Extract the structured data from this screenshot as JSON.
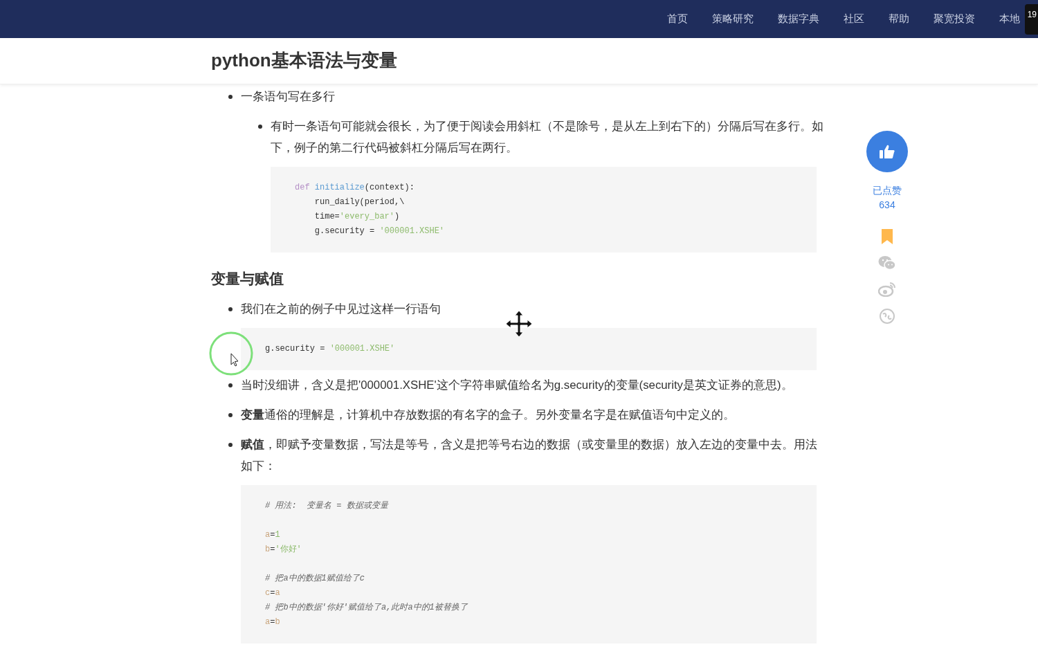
{
  "nav": {
    "items": [
      {
        "label": "首页",
        "selected": false
      },
      {
        "label": "策略研究",
        "selected": false
      },
      {
        "label": "数据字典",
        "selected": false
      },
      {
        "label": "社区",
        "selected": false
      },
      {
        "label": "帮助",
        "selected": false
      },
      {
        "label": "聚宽投资",
        "selected": false
      },
      {
        "label": "本地",
        "selected": false
      }
    ],
    "tooltip": "19"
  },
  "title": "python基本语法与变量",
  "content": [
    {
      "kind": "bullet",
      "text": "一条语句写在多行",
      "children": [
        {
          "kind": "bullet",
          "text": "有时一条语句可能就会很长，为了便于阅读会用斜杠（不是除号，是从左上到右下的）分隔后写在多行。如下，例子的第二行代码被斜杠分隔后写在两行。",
          "children": [
            {
              "kind": "code",
              "lines": [
                {
                  "kind": "code",
                  "segments": [
                    {
                      "kind": "keyword",
                      "text": "def "
                    },
                    {
                      "kind": "function",
                      "text": "initialize"
                    },
                    {
                      "kind": "plain",
                      "text": "(context):"
                    }
                  ]
                },
                {
                  "kind": "code",
                  "segments": [
                    {
                      "kind": "plain",
                      "text": "    run_daily(period,\\"
                    }
                  ]
                },
                {
                  "kind": "code",
                  "segments": [
                    {
                      "kind": "plain",
                      "text": "    time="
                    },
                    {
                      "kind": "string",
                      "text": "'every_bar'"
                    },
                    {
                      "kind": "plain",
                      "text": ")"
                    }
                  ]
                },
                {
                  "kind": "code",
                  "segments": [
                    {
                      "kind": "plain",
                      "text": "    g.security = "
                    },
                    {
                      "kind": "string",
                      "text": "'000001.XSHE'"
                    }
                  ]
                }
              ]
            }
          ]
        }
      ]
    },
    {
      "kind": "heading",
      "text": "变量与赋值"
    },
    {
      "kind": "bullet",
      "text": "我们在之前的例子中见过这样一行语句",
      "children": [
        {
          "kind": "code",
          "lines": [
            {
              "kind": "code",
              "segments": [
                {
                  "kind": "plain",
                  "text": "g.security = "
                },
                {
                  "kind": "string",
                  "text": "'000001.XSHE'"
                }
              ]
            }
          ]
        }
      ]
    },
    {
      "kind": "bullet",
      "text": "当时没细讲，含义是把'000001.XSHE'这个字符串赋值给名为g.security的变量(security是英文证券的意思)。"
    },
    {
      "kind": "bullet",
      "text": "**变量**通俗的理解是，计算机中存放数据的有名字的盒子。另外变量名字是在赋值语句中定义的。"
    },
    {
      "kind": "bullet",
      "text": "**赋值**，即赋予变量数据，写法是等号，含义是把等号右边的数据（或变量里的数据）放入左边的变量中去。用法如下：",
      "children": [
        {
          "kind": "code",
          "lines": [
            {
              "kind": "code",
              "segments": [
                {
                  "kind": "comment",
                  "text": "# 用法:  变量名 = 数据或变量"
                }
              ]
            },
            {
              "kind": "blank"
            },
            {
              "kind": "code",
              "segments": [
                {
                  "kind": "variable",
                  "text": "a"
                },
                {
                  "kind": "plain",
                  "text": "="
                },
                {
                  "kind": "number",
                  "text": "1"
                }
              ]
            },
            {
              "kind": "code",
              "segments": [
                {
                  "kind": "variable",
                  "text": "b"
                },
                {
                  "kind": "plain",
                  "text": "="
                },
                {
                  "kind": "string",
                  "text": "'你好'"
                }
              ]
            },
            {
              "kind": "blank"
            },
            {
              "kind": "code",
              "segments": [
                {
                  "kind": "comment",
                  "text": "# 把a中的数据1赋值给了c"
                }
              ]
            },
            {
              "kind": "code",
              "segments": [
                {
                  "kind": "variable",
                  "text": "c"
                },
                {
                  "kind": "plain",
                  "text": "="
                },
                {
                  "kind": "variable",
                  "text": "a"
                }
              ]
            },
            {
              "kind": "code",
              "segments": [
                {
                  "kind": "comment",
                  "text": "# 把b中的数据'你好'赋值给了a,此时a中的1被替换了"
                }
              ]
            },
            {
              "kind": "code",
              "segments": [
                {
                  "kind": "variable",
                  "text": "a"
                },
                {
                  "kind": "plain",
                  "text": "="
                },
                {
                  "kind": "variable",
                  "text": "b"
                }
              ]
            }
          ]
        }
      ]
    }
  ],
  "sidebar": {
    "like": {
      "liked": true,
      "label": "已点赞",
      "count": "634"
    },
    "bookmarked": true,
    "share_icons": [
      {
        "kind": "wechat"
      },
      {
        "kind": "weibo"
      },
      {
        "kind": "circle"
      }
    ]
  }
}
